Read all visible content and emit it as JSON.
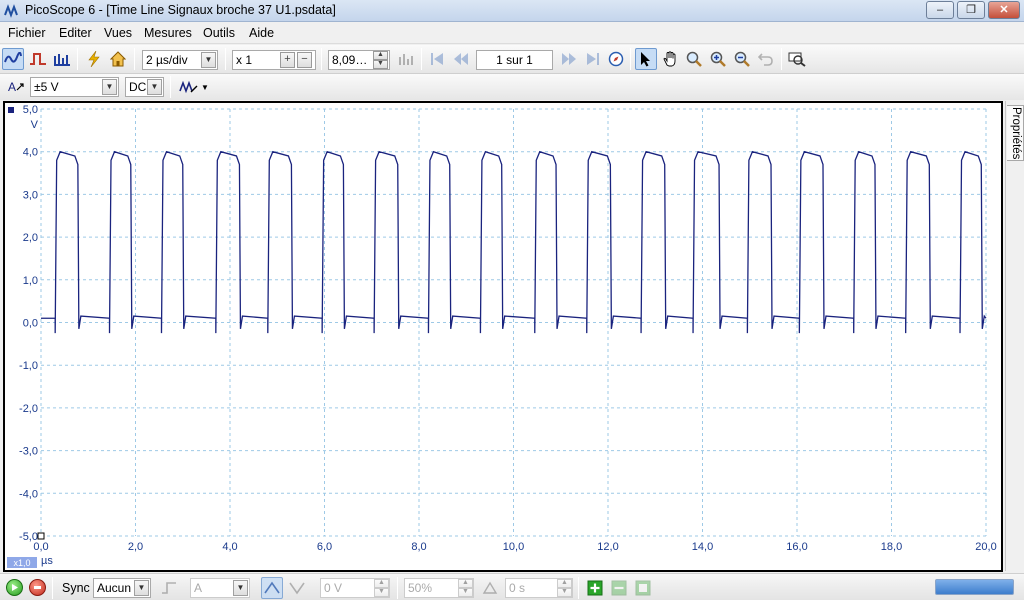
{
  "window": {
    "title": "PicoScope 6 - [Time Line Signaux broche 37 U1.psdata]",
    "buttons": {
      "minimize": "–",
      "maximize": "❐",
      "close": "✕"
    }
  },
  "menu": {
    "items": [
      "Fichier",
      "Editer",
      "Vues",
      "Mesures",
      "Outils",
      "Aide"
    ]
  },
  "toolbar": {
    "timebase": "2 µs/div",
    "zoom": "x 1",
    "samples": "8,09…",
    "buffer_page": "1 sur 1"
  },
  "channel": {
    "label": "A",
    "range": "±5 V",
    "coupling": "DC"
  },
  "side_panel": {
    "tab_label": "Propriétés"
  },
  "status": {
    "sync_label": "Sync",
    "sync_mode": "Aucun",
    "trigger_channel": "A",
    "threshold": "0 V",
    "position": "50%",
    "delay": "0 s"
  },
  "colors": {
    "trace": "#1a237e",
    "grid": "#9ec9e6",
    "axis_text": "#1a3a8c"
  },
  "chart_data": {
    "type": "line",
    "title": "",
    "xlabel": "µs",
    "ylabel": "V",
    "xlim": [
      0,
      20
    ],
    "ylim": [
      -5,
      5
    ],
    "x_ticks": [
      "0,0",
      "2,0",
      "4,0",
      "6,0",
      "8,0",
      "10,0",
      "12,0",
      "14,0",
      "16,0",
      "18,0",
      "20,0"
    ],
    "y_ticks": [
      "5,0",
      "4,0",
      "3,0",
      "2,0",
      "1,0",
      "0,0",
      "-1,0",
      "-2,0",
      "-3,0",
      "-4,0",
      "-5,0"
    ],
    "x_scale_badge": "x1,0",
    "grid": true,
    "series": [
      {
        "high_level": 3.95,
        "low_level": 0.1,
        "pulses": [
          [
            0.3,
            0.78
          ],
          [
            1.45,
            1.9
          ],
          [
            2.55,
            3.0
          ],
          [
            3.7,
            4.2
          ],
          [
            4.8,
            5.3
          ],
          [
            5.95,
            6.4
          ],
          [
            7.05,
            7.55
          ],
          [
            8.2,
            8.65
          ],
          [
            9.3,
            9.75
          ],
          [
            10.45,
            10.9
          ],
          [
            11.55,
            12.05
          ],
          [
            12.7,
            13.2
          ],
          [
            13.8,
            14.35
          ],
          [
            14.95,
            15.45
          ],
          [
            16.05,
            16.55
          ],
          [
            17.2,
            17.65
          ],
          [
            18.3,
            18.8
          ],
          [
            19.45,
            19.9
          ]
        ]
      }
    ]
  }
}
